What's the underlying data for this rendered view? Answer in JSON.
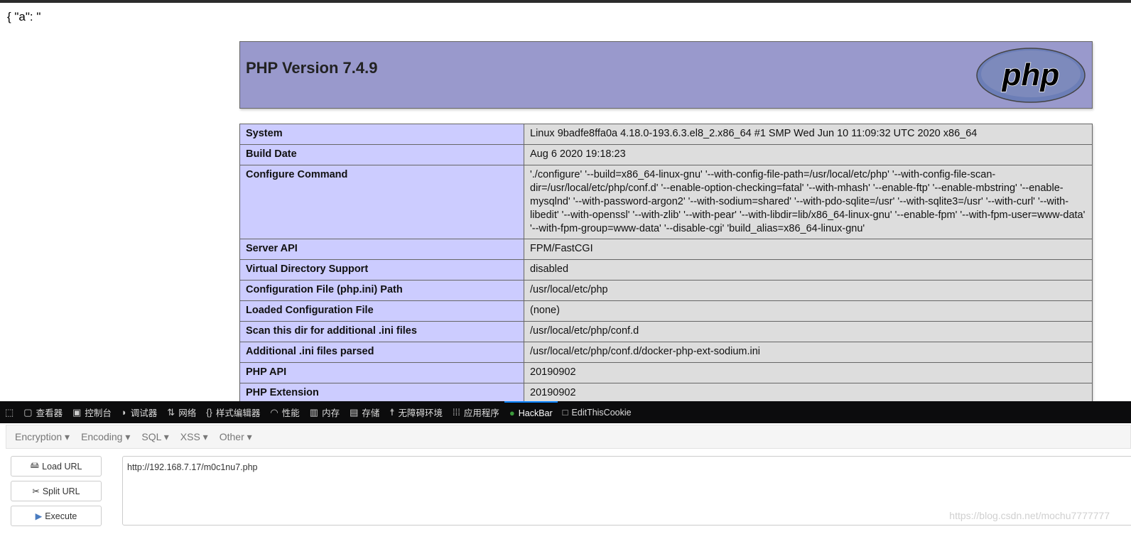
{
  "page_text": "{ \"a\": \"",
  "php": {
    "title": "PHP Version 7.4.9",
    "logo_text": "php"
  },
  "rows": [
    {
      "k": "System",
      "v": "Linux 9badfe8ffa0a 4.18.0-193.6.3.el8_2.x86_64 #1 SMP Wed Jun 10 11:09:32 UTC 2020 x86_64"
    },
    {
      "k": "Build Date",
      "v": "Aug 6 2020 19:18:23"
    },
    {
      "k": "Configure Command",
      "v": "'./configure' '--build=x86_64-linux-gnu' '--with-config-file-path=/usr/local/etc/php' '--with-config-file-scan-dir=/usr/local/etc/php/conf.d' '--enable-option-checking=fatal' '--with-mhash' '--enable-ftp' '--enable-mbstring' '--enable-mysqlnd' '--with-password-argon2' '--with-sodium=shared' '--with-pdo-sqlite=/usr' '--with-sqlite3=/usr' '--with-curl' '--with-libedit' '--with-openssl' '--with-zlib' '--with-pear' '--with-libdir=lib/x86_64-linux-gnu' '--enable-fpm' '--with-fpm-user=www-data' '--with-fpm-group=www-data' '--disable-cgi' 'build_alias=x86_64-linux-gnu'"
    },
    {
      "k": "Server API",
      "v": "FPM/FastCGI"
    },
    {
      "k": "Virtual Directory Support",
      "v": "disabled"
    },
    {
      "k": "Configuration File (php.ini) Path",
      "v": "/usr/local/etc/php"
    },
    {
      "k": "Loaded Configuration File",
      "v": "(none)"
    },
    {
      "k": "Scan this dir for additional .ini files",
      "v": "/usr/local/etc/php/conf.d"
    },
    {
      "k": "Additional .ini files parsed",
      "v": "/usr/local/etc/php/conf.d/docker-php-ext-sodium.ini"
    },
    {
      "k": "PHP API",
      "v": "20190902"
    },
    {
      "k": "PHP Extension",
      "v": "20190902"
    }
  ],
  "devtools": {
    "tabs": [
      {
        "label": "查看器",
        "icon": "inspector-icon"
      },
      {
        "label": "控制台",
        "icon": "console-icon"
      },
      {
        "label": "调试器",
        "icon": "debugger-icon"
      },
      {
        "label": "网络",
        "icon": "network-icon"
      },
      {
        "label": "样式编辑器",
        "icon": "style-editor-icon"
      },
      {
        "label": "性能",
        "icon": "performance-icon"
      },
      {
        "label": "内存",
        "icon": "memory-icon"
      },
      {
        "label": "存储",
        "icon": "storage-icon"
      },
      {
        "label": "无障碍环境",
        "icon": "accessibility-icon"
      },
      {
        "label": "应用程序",
        "icon": "application-icon"
      },
      {
        "label": "HackBar",
        "icon": "hackbar-icon",
        "active": true
      },
      {
        "label": "EditThisCookie",
        "icon": "cookie-icon"
      }
    ],
    "accent": "#0a84ff"
  },
  "hackbar": {
    "menu": [
      "Encryption ▾",
      "Encoding ▾",
      "SQL ▾",
      "XSS ▾",
      "Other ▾"
    ],
    "load_url": "Load URL",
    "split_url": "Split URL",
    "execute": "Execute",
    "url": "http://192.168.7.17/m0c1nu7.php"
  },
  "watermark": "https://blog.csdn.net/mochu7777777"
}
